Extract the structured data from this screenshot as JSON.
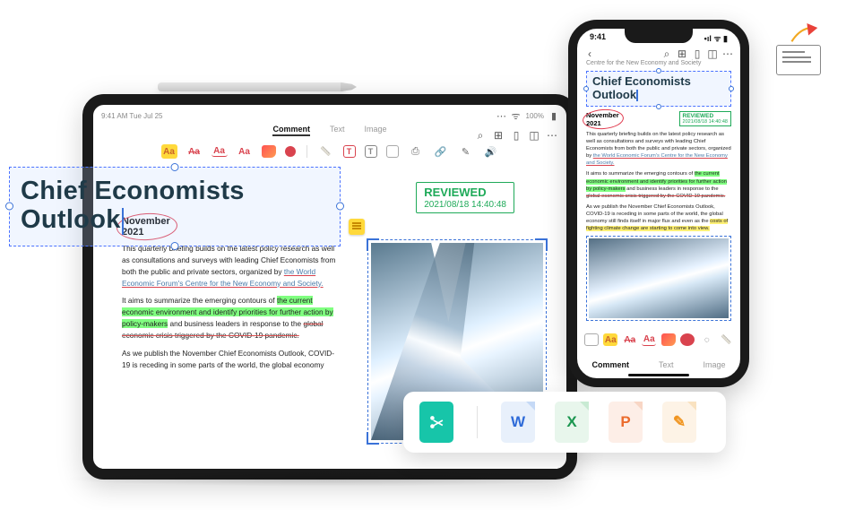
{
  "document": {
    "title_line1": "Chief Economists",
    "title_line2": "Outlook",
    "header": "Centre for the New Economy and Society",
    "date": "November",
    "year": "2021",
    "para1_a": "This quarterly briefing builds on the latest policy research as well as consultations and surveys with leading Chief Economists from both the public and private sectors, organized by ",
    "para1_link": "the World Economic Forum's Centre for the New Economy and Society.",
    "para2_a": "It aims to summarize the emerging contours of ",
    "para2_hl": "the current economic environment and identify priorities for further action by policy-makers",
    "para2_b": " and business leaders in response to the ",
    "para2_sk": "global economic crisis triggered by the COVID-19 pandemic.",
    "para3_a": "As we publish the November Chief Economists Outlook, COVID-19 is receding in some parts of the world, the global economy",
    "para3_b": " still finds itself in major flux and even as the ",
    "para3_yl": "costs of fighting climate change are starting to come into view."
  },
  "stamp": {
    "label": "REVIEWED",
    "timestamp": "2021/08/18 14:40:48"
  },
  "ipad": {
    "time": "9:41 AM Tue Jul 25",
    "battery": "100%",
    "tabs": [
      "Comment",
      "Text",
      "Image"
    ],
    "active_tab": "Comment"
  },
  "phone": {
    "time": "9:41",
    "tabs": [
      "Comment",
      "Text",
      "Image"
    ],
    "active_tab": "Comment"
  },
  "tools": {
    "highlight": "Aa",
    "strike": "Aa",
    "underline": "Aa",
    "squiggle": "Aa",
    "textRed": "T",
    "textGray": "T"
  },
  "export": {
    "scissors": "scissors",
    "word": "W",
    "excel": "X",
    "ppt": "P",
    "pages": "✎"
  }
}
